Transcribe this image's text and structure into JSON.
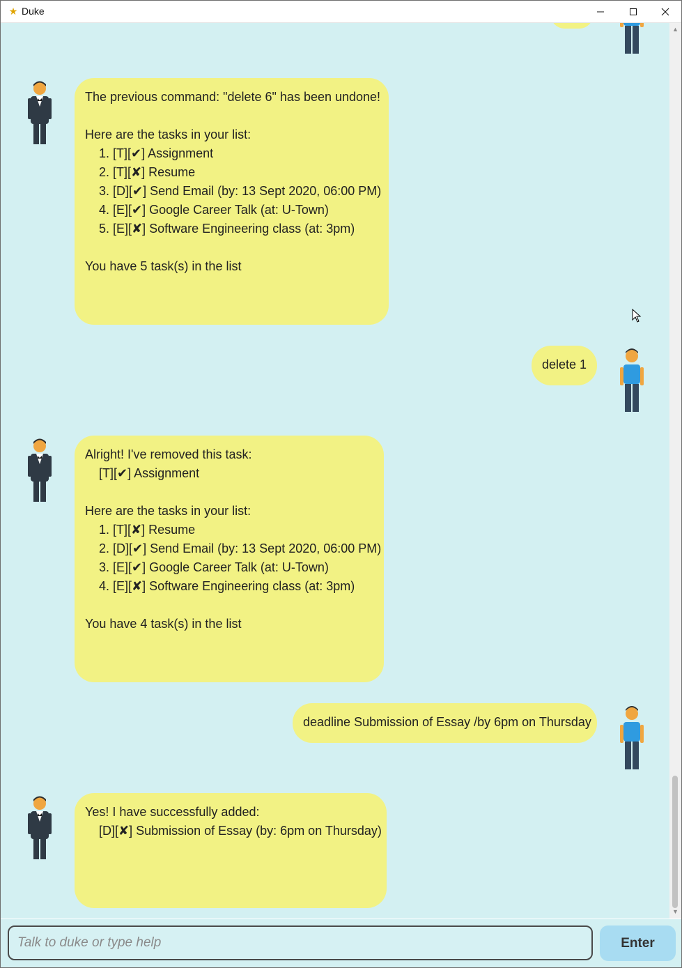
{
  "window": {
    "title": "Duke",
    "app_icon": "duke-app-icon",
    "controls": [
      "minimize",
      "maximize",
      "close"
    ]
  },
  "colors": {
    "chat_background": "#d3f0f2",
    "bubble": "#f2f284",
    "enter_button": "#a8dcf2",
    "user_shirt": "#2f9be0",
    "bot_suit": "#2f3a45"
  },
  "messages": [
    {
      "sender": "duke",
      "lines": [
        "The previous command: \"delete 6\" has been undone!",
        "",
        "Here are the tasks in your list:",
        "    1. [T][✔] Assignment",
        "    2. [T][✘] Resume",
        "    3. [D][✔] Send Email (by: 13 Sept 2020, 06:00 PM)",
        "    4. [E][✔] Google Career Talk (at: U-Town)",
        "    5. [E][✘] Software Engineering class (at: 3pm)",
        "",
        "You have 5 task(s) in the list"
      ]
    },
    {
      "sender": "user",
      "lines": [
        "delete 1"
      ]
    },
    {
      "sender": "duke",
      "lines": [
        "Alright! I've removed this task:",
        "    [T][✔] Assignment",
        "",
        "Here are the tasks in your list:",
        "    1. [T][✘] Resume",
        "    2. [D][✔] Send Email (by: 13 Sept 2020, 06:00 PM)",
        "    3. [E][✔] Google Career Talk (at: U-Town)",
        "    4. [E][✘] Software Engineering class (at: 3pm)",
        "",
        "You have 4 task(s) in the list"
      ]
    },
    {
      "sender": "user",
      "lines": [
        "deadline Submission of Essay /by 6pm on Thursday"
      ]
    },
    {
      "sender": "duke",
      "lines": [
        "Yes! I have successfully added:",
        "    [D][✘] Submission of Essay (by: 6pm on Thursday)"
      ]
    }
  ],
  "input": {
    "placeholder": "Talk to duke or type help",
    "value": ""
  },
  "enter_button": {
    "label": "Enter"
  }
}
